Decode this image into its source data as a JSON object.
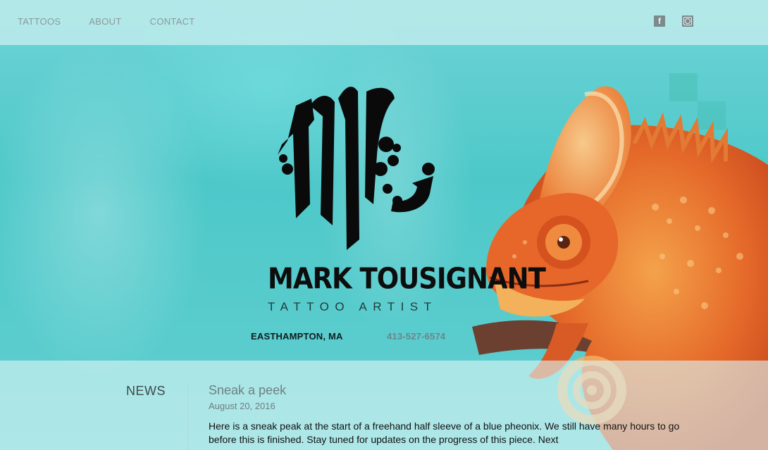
{
  "nav": {
    "items": [
      "TATTOOS",
      "ABOUT",
      "CONTACT"
    ]
  },
  "social": {
    "facebook_icon": "facebook-icon",
    "instagram_icon": "instagram-icon"
  },
  "brand": {
    "name": "MARK TOUSIGNANT",
    "tagline": "TATTOO ARTIST",
    "location": "EASTHAMPTON, MA",
    "phone": "413-527-6574"
  },
  "news": {
    "label": "NEWS",
    "post": {
      "title": "Sneak a peek",
      "date": "August 20, 2016",
      "body": "Here is a sneak peak at the start of a freehand half sleeve of a blue pheonix. We still have many hours to go before this is finished. Stay tuned for updates on the progress of this piece. Next"
    }
  },
  "colors": {
    "background_teal": "#5ccccd",
    "nav_text": "#8a9a9d",
    "chameleon_orange": "#e8682c"
  }
}
